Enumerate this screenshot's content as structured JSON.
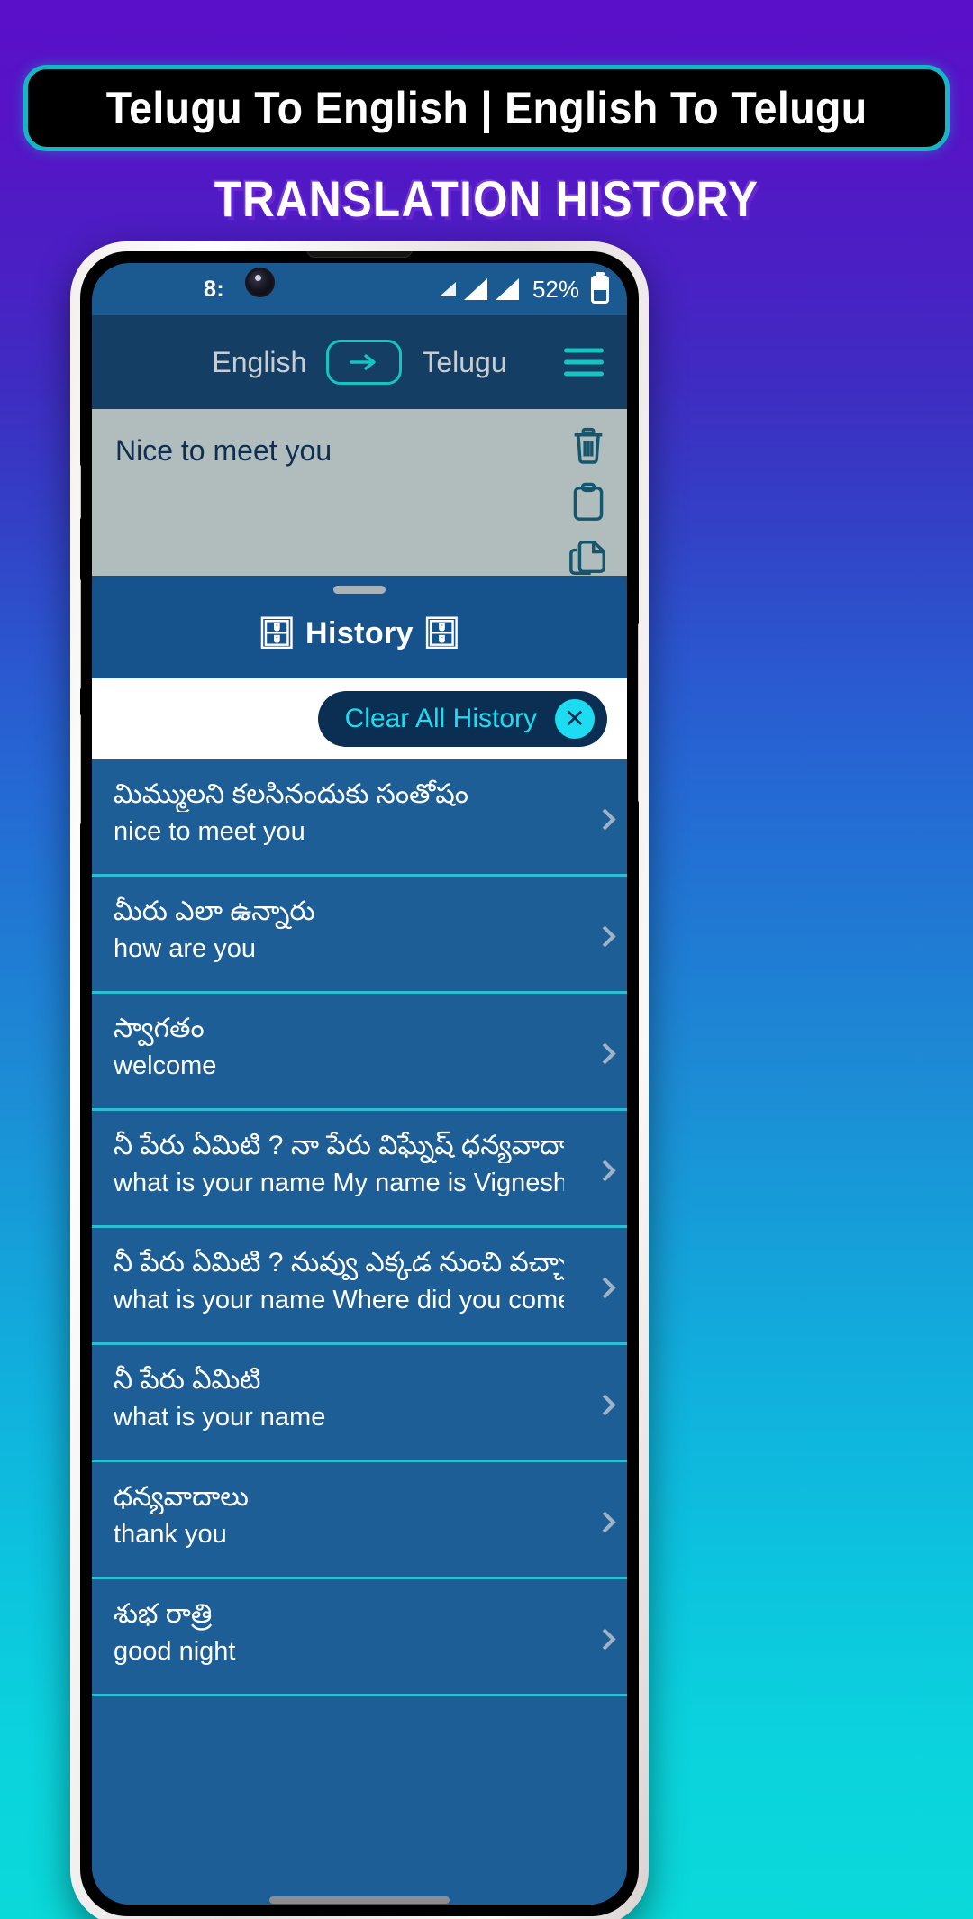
{
  "promo": {
    "title": "Telugu To English | English To Telugu",
    "subtitle": "TRANSLATION HISTORY"
  },
  "status_bar": {
    "time": "8:",
    "battery_percent": "52%",
    "signal_icon": "signal-bars-icon",
    "battery_icon": "battery-icon"
  },
  "toolbar": {
    "source_language": "English",
    "target_language": "Telugu",
    "swap_icon": "arrow-right-icon",
    "menu_icon": "hamburger-menu-icon"
  },
  "input_panel": {
    "text": "Nice to meet you",
    "tools": [
      {
        "name": "delete-icon",
        "label": "Delete"
      },
      {
        "name": "paste-icon",
        "label": "Paste"
      },
      {
        "name": "copy-icon",
        "label": "Copy"
      }
    ]
  },
  "history_sheet": {
    "title": "🗄 History 🗄",
    "title_text": "History",
    "clear_button_label": "Clear All History",
    "clear_button_icon": "close-circle-icon",
    "items": [
      {
        "source": "మిమ్ములని కలసినందుకు సంతోషం",
        "target": "nice to meet you"
      },
      {
        "source": "మీరు ఎలా ఉన్నారు",
        "target": "how are you"
      },
      {
        "source": "స్వాగతం",
        "target": "welcome"
      },
      {
        "source": "నీ పేరు ఏమిటి ? నా పేరు విఘ్నేష్ ధన్యవాదాలు",
        "target": "what is your name My name is Vignesh th…"
      },
      {
        "source": "నీ పేరు ఏమిటి ? నువ్వు ఎక్కడ నుంచి వచ్చావు ?…",
        "target": "what is your name Where did you come fr…"
      },
      {
        "source": "నీ పేరు ఏమిటి",
        "target": "what is your name"
      },
      {
        "source": "ధన్యవాదాలు",
        "target": "thank you"
      },
      {
        "source": "శుభ రాత్రి",
        "target": "good night"
      }
    ]
  },
  "colors": {
    "banner_border": "#17b6c4",
    "accent_teal": "#13c4c0",
    "toolbar_bg": "#143e63",
    "sheet_bg": "#16538c",
    "list_bg": "#1d5e96",
    "divider": "#2bbfd6",
    "clear_btn_bg": "#0b2f52",
    "clear_btn_text": "#1ddbf0",
    "input_bg": "#b1bdbd",
    "input_text": "#0f2f52",
    "status_bg": "#1b5a91"
  }
}
